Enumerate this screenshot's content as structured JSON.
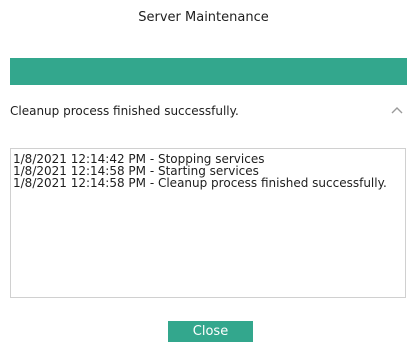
{
  "window": {
    "title": "Server Maintenance"
  },
  "progress": {
    "percent": 100,
    "color": "#33a78d"
  },
  "status": {
    "text": "Cleanup process finished successfully.",
    "toggle_icon": "chevron-up-icon"
  },
  "log": {
    "lines": [
      "1/8/2021 12:14:42 PM - Stopping services",
      "1/8/2021 12:14:58 PM - Starting services",
      "1/8/2021 12:14:58 PM - Cleanup process finished successfully."
    ]
  },
  "actions": {
    "close_label": "Close"
  },
  "colors": {
    "accent": "#33a78d"
  }
}
